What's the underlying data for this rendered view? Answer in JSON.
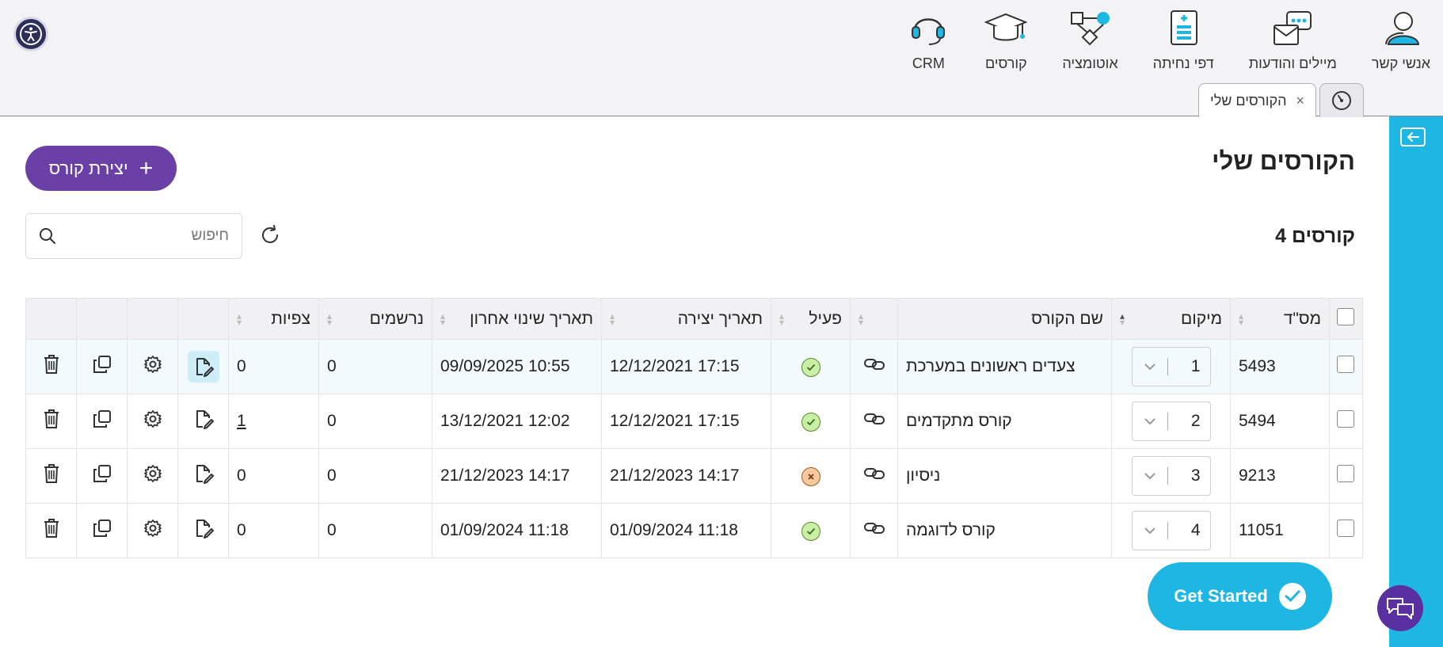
{
  "nav": {
    "items": [
      {
        "label": "אנשי קשר",
        "icon": "contacts-icon"
      },
      {
        "label": "מיילים והודעות",
        "icon": "messages-icon"
      },
      {
        "label": "דפי נחיתה",
        "icon": "landing-pages-icon"
      },
      {
        "label": "אוטומציה",
        "icon": "automation-icon"
      },
      {
        "label": "קורסים",
        "icon": "courses-icon"
      },
      {
        "label": "CRM",
        "icon": "headset-icon"
      }
    ]
  },
  "tabs": {
    "active_label": "הקורסים שלי",
    "close": "×"
  },
  "page": {
    "title": "הקורסים שלי",
    "create_label": "יצירת קורס",
    "create_plus": "+",
    "count": "4 קורסים"
  },
  "search": {
    "placeholder": "חיפוש"
  },
  "table": {
    "headers": {
      "id": "מס\"ד",
      "position": "מיקום",
      "name": "שם הקורס",
      "active": "פעיל",
      "created": "תאריך יצירה",
      "modified": "תאריך שינוי אחרון",
      "registered": "נרשמים",
      "views": "צפיות"
    },
    "rows": [
      {
        "id": "5493",
        "position": "1",
        "name": "צעדים ראשונים במערכת",
        "active": true,
        "created": "17:15 12/12/2021",
        "modified": "10:55 09/09/2025",
        "registered": "0",
        "views": "0"
      },
      {
        "id": "5494",
        "position": "2",
        "name": "קורס מתקדמים",
        "active": true,
        "created": "17:15 12/12/2021",
        "modified": "12:02 13/12/2021",
        "registered": "0",
        "views": "1"
      },
      {
        "id": "9213",
        "position": "3",
        "name": "ניסיון",
        "active": false,
        "created": "14:17 21/12/2023",
        "modified": "14:17 21/12/2023",
        "registered": "0",
        "views": "0"
      },
      {
        "id": "11051",
        "position": "4",
        "name": "קורס לדוגמה",
        "active": true,
        "created": "11:18 01/09/2024",
        "modified": "11:18 01/09/2024",
        "registered": "0",
        "views": "0"
      }
    ]
  },
  "get_started": {
    "label": "Get Started"
  },
  "colors": {
    "brand_purple": "#6a3fa6",
    "accent_cyan": "#1eb6e3",
    "active_green": "#c9efa6",
    "inactive_orange": "#f8c8a0"
  }
}
